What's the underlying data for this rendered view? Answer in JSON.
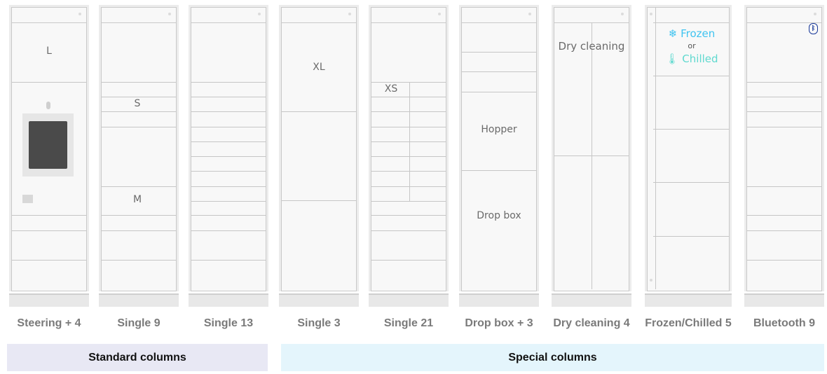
{
  "columns": [
    {
      "name": "Steering + 4",
      "box_labels": [
        "L"
      ]
    },
    {
      "name": "Single 9",
      "box_labels": [
        "S",
        "M"
      ]
    },
    {
      "name": "Single 13",
      "box_labels": []
    },
    {
      "name": "Single 3",
      "box_labels": [
        "XL"
      ]
    },
    {
      "name": "Single 21",
      "box_labels": [
        "XS"
      ]
    },
    {
      "name": "Drop box + 3",
      "box_labels": [
        "Hopper",
        "Drop box"
      ]
    },
    {
      "name": "Dry cleaning 4",
      "box_labels": [
        "Dry cleaning"
      ]
    },
    {
      "name": "Frozen/Chilled 5",
      "box_labels": [
        "Frozen",
        "or",
        "Chilled"
      ],
      "icons": [
        "snowflake-icon",
        "thermometer-icon"
      ]
    },
    {
      "name": "Bluetooth 9",
      "box_labels": [],
      "icons": [
        "bluetooth-icon"
      ]
    }
  ],
  "groups": [
    {
      "label": "Standard columns",
      "color": "#e8e8f4"
    },
    {
      "label": "Special columns",
      "color": "#e4f5fc"
    }
  ],
  "colors": {
    "frozen": "#3fc3f0",
    "chilled": "#5fd9cf",
    "bluetooth": "#1a3a9a",
    "screen": "#4a4a4a"
  }
}
